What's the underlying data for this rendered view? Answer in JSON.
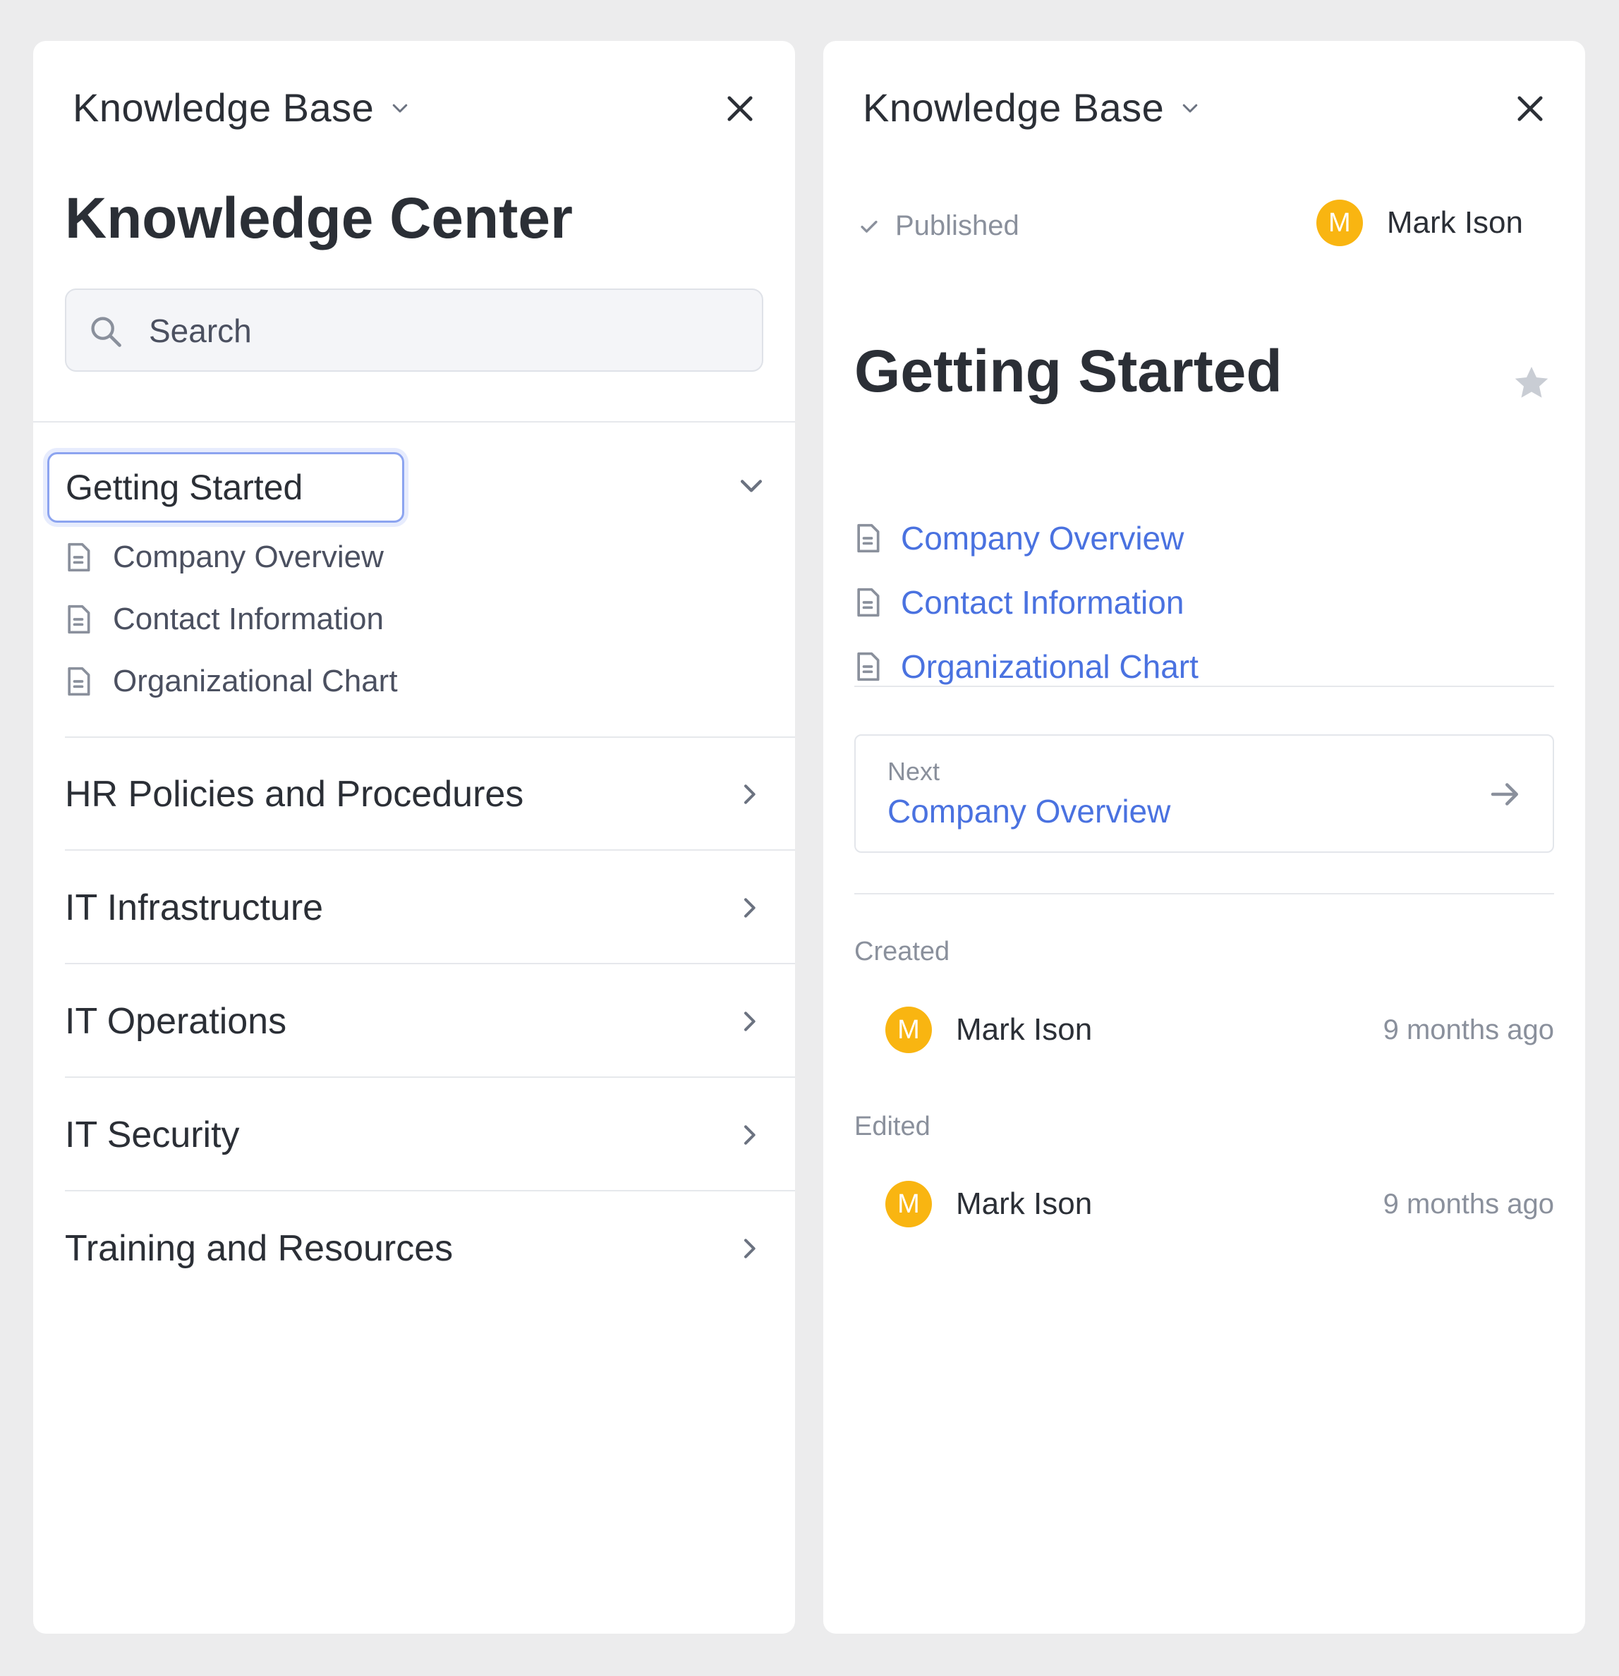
{
  "left": {
    "topbar_title": "Knowledge Base",
    "heading": "Knowledge Center",
    "search_placeholder": "Search",
    "open_section": {
      "label": "Getting Started",
      "items": [
        "Company Overview",
        "Contact Information",
        "Organizational Chart"
      ]
    },
    "sections": [
      "HR Policies and Procedures",
      "IT Infrastructure",
      "IT Operations",
      "IT Security",
      "Training and Resources"
    ]
  },
  "right": {
    "topbar_title": "Knowledge Base",
    "status": "Published",
    "author": "Mark Ison",
    "author_initial": "M",
    "title": "Getting Started",
    "toc": [
      "Company Overview",
      "Contact Information",
      "Organizational Chart"
    ],
    "next": {
      "label": "Next",
      "title": "Company Overview"
    },
    "created": {
      "label": "Created",
      "name": "Mark Ison",
      "initial": "M",
      "time": "9 months ago"
    },
    "edited": {
      "label": "Edited",
      "name": "Mark Ison",
      "initial": "M",
      "time": "9 months ago"
    }
  },
  "colors": {
    "accent": "#4a72e0",
    "avatar": "#f9b511",
    "focus_ring": "#8ca4f0",
    "muted": "#8a909c"
  },
  "icons": [
    "chevron-down-icon",
    "close-icon",
    "search-icon",
    "document-icon",
    "chevron-right-icon",
    "check-icon",
    "star-icon",
    "arrow-right-icon"
  ]
}
